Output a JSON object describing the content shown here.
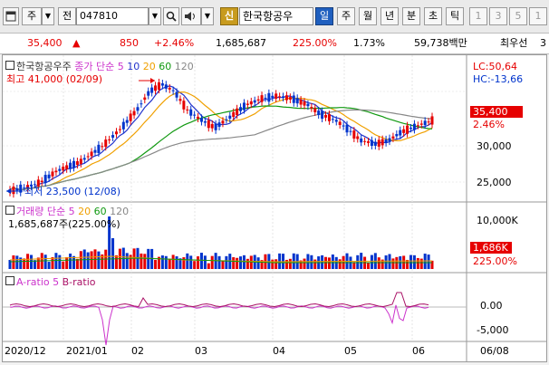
{
  "toolbar": {
    "mode_label": "주",
    "prefix_label": "전",
    "code": "047810",
    "new_badge": "신",
    "company_name": "한국항공우",
    "period_tabs": [
      "일",
      "주",
      "월",
      "년",
      "분",
      "초",
      "틱"
    ],
    "active_period": "일",
    "minute_options": [
      "1",
      "3",
      "5",
      "1"
    ]
  },
  "quote": {
    "price": "35,400",
    "change": "850",
    "change_pct": "+2.46%",
    "volume": "1,685,687",
    "volume_ratio": "225.00%",
    "turnover": "1.73%",
    "amount": "59,738백만",
    "tag": "최우선",
    "tail": "3"
  },
  "price_panel": {
    "legend_name": "한국항공우주",
    "legend_ma": "종가 단순 5",
    "ma_periods": [
      "10",
      "20",
      "60",
      "120"
    ],
    "high_label": "최고 41,000 (02/09)",
    "low_label": "최저 23,500 (12/08)",
    "lc": "LC:50,64",
    "hc": "HC:-13,66",
    "price_badge": "35,400",
    "pct_badge": "2.46%",
    "axis_ticks": [
      "30,000",
      "25,000"
    ]
  },
  "volume_panel": {
    "legend": "거래량 단순 5",
    "ma_periods": [
      "20",
      "60",
      "120"
    ],
    "summary": "1,685,687주(225.00%)",
    "axis_tick": "10,000K",
    "volume_badge": "1,686K",
    "pct_badge": "225.00%"
  },
  "ratio_panel": {
    "legend_a": "A-ratio 5",
    "legend_b": "B-ratio",
    "axis_ticks": [
      "0.00",
      "-5,000"
    ]
  },
  "x_axis": {
    "labels": [
      "2020/12",
      "2021/01",
      "02",
      "03",
      "04",
      "05",
      "06",
      "06/08"
    ]
  },
  "colors": {
    "up": "#e60000",
    "down": "#0033cc",
    "ma5": "#cc33cc",
    "ma10": "#2233cc",
    "ma20": "#f0a000",
    "ma60": "#119911",
    "ma120": "#888888",
    "toolbar_active": "#1f5fbf"
  }
}
